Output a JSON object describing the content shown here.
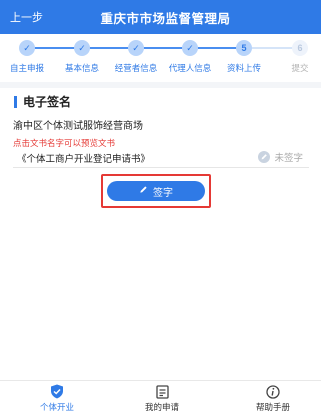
{
  "header": {
    "back_label": "上一步",
    "title": "重庆市市场监督管理局"
  },
  "steps": [
    {
      "label": "自主申报",
      "mark": "✓",
      "state": "done"
    },
    {
      "label": "基本信息",
      "mark": "✓",
      "state": "done"
    },
    {
      "label": "经营者信息",
      "mark": "✓",
      "state": "done"
    },
    {
      "label": "代理人信息",
      "mark": "✓",
      "state": "done"
    },
    {
      "label": "资料上传",
      "mark": "5",
      "state": "current"
    },
    {
      "label": "提交",
      "mark": "6",
      "state": "todo"
    }
  ],
  "section": {
    "title": "电子签名",
    "company": "渝中区个体测试服饰经营商场",
    "hint": "点击文书名字可以预览文书",
    "document": {
      "name": "《个体工商户开业登记申请书》",
      "status": "未签字"
    },
    "sign_button": "签字"
  },
  "tabbar": {
    "items": [
      {
        "label": "个体开业",
        "icon": "shield-check-icon",
        "active": true
      },
      {
        "label": "我的申请",
        "icon": "document-list-icon",
        "active": false
      },
      {
        "label": "帮助手册",
        "icon": "info-icon",
        "active": false
      }
    ]
  },
  "colors": {
    "primary": "#2f7ae6",
    "highlight_border": "#e53935",
    "hint_text": "#e53935"
  }
}
